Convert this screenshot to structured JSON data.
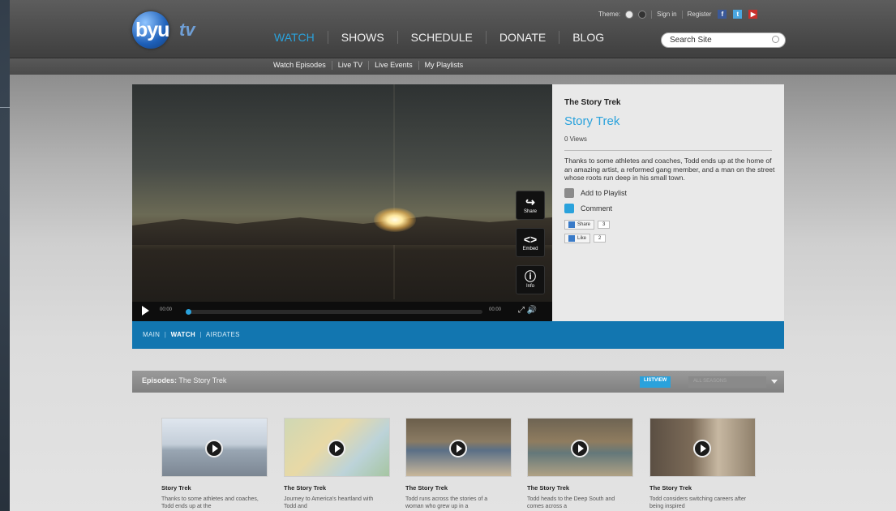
{
  "header": {
    "logo": "byu",
    "logo_tv": "tv",
    "theme_label": "Theme:",
    "theme_light": " ",
    "sign_in": "Sign in",
    "register": "Register",
    "search_placeholder": "Search Site",
    "nav": [
      "WATCH",
      "SHOWS",
      "SCHEDULE",
      "DONATE",
      "BLOG"
    ],
    "subnav": [
      "Watch Episodes",
      "Live TV",
      "Live Events",
      "My Playlists"
    ],
    "accent": "#2aa2dc"
  },
  "player": {
    "time_elapsed": "00:00",
    "time_total": "00:00",
    "side_buttons": [
      "Share",
      "Embed",
      "Info"
    ]
  },
  "info": {
    "show": "The Story Trek",
    "title": "Story Trek",
    "views": "0 Views",
    "description": "Thanks to some athletes and coaches, Todd ends up at the home of an amazing artist, a reformed gang member, and a man on the street whose roots run deep in his small town.",
    "add_to_playlist": "Add to Playlist",
    "comment": "Comment",
    "share_label": "Share",
    "share_count": "3",
    "like_label": "Like",
    "like_count": "2"
  },
  "showtabs": {
    "items": [
      "MAIN",
      "WATCH",
      "AIRDATES"
    ],
    "current": "WATCH"
  },
  "episodes": {
    "label": "Episodes:",
    "show": "The Story Trek",
    "listview": "LISTVIEW",
    "season": "ALL SEASONS",
    "items": [
      {
        "title": "Story Trek",
        "desc": "Thanks to some athletes and coaches, Todd ends up at the"
      },
      {
        "title": "The Story Trek",
        "desc": "Journey to America's heartland with Todd and"
      },
      {
        "title": "The Story Trek",
        "desc": "Todd runs across the stories of a woman who grew up in a"
      },
      {
        "title": "The Story Trek",
        "desc": "Todd heads to the Deep South and comes across a"
      },
      {
        "title": "The Story Trek",
        "desc": "Todd considers switching careers after being inspired"
      }
    ]
  }
}
